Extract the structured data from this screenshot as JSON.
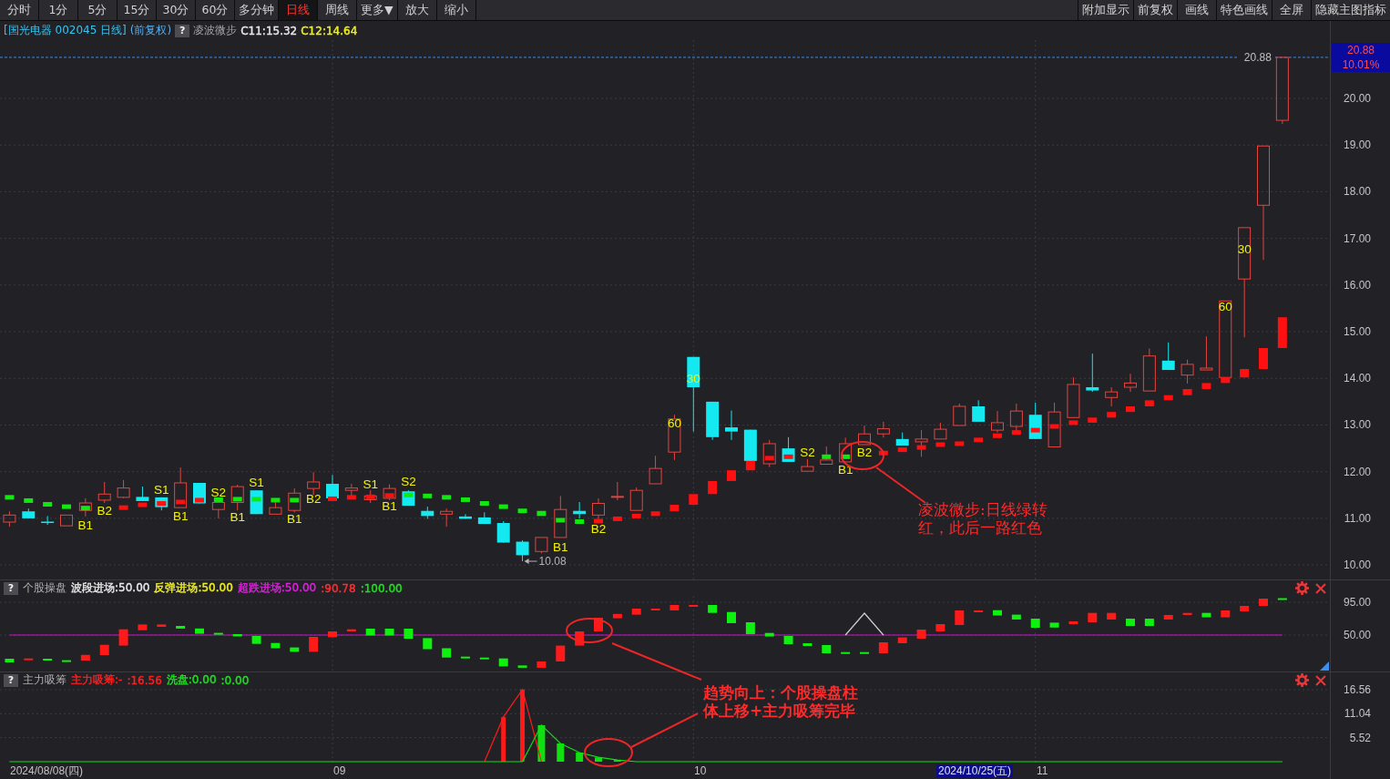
{
  "toolbar": {
    "left": [
      {
        "label": "分时",
        "selected": false
      },
      {
        "label": "1分",
        "selected": false
      },
      {
        "label": "5分",
        "selected": false
      },
      {
        "label": "15分",
        "selected": false
      },
      {
        "label": "30分",
        "selected": false
      },
      {
        "label": "60分",
        "selected": false
      },
      {
        "label": "多分钟",
        "selected": false
      },
      {
        "label": "日线",
        "selected": true
      },
      {
        "label": "周线",
        "selected": false
      },
      {
        "label": "更多▼",
        "selected": false
      },
      {
        "label": "放大",
        "selected": false
      },
      {
        "label": "缩小",
        "selected": false
      }
    ],
    "right": [
      "附加显示",
      "前复权",
      "画线",
      "特色画线",
      "全屏",
      "隐藏主图指标"
    ]
  },
  "info_bar": {
    "title": "[国光电器 002045 日线]",
    "adjust": "(前复权)",
    "help": "?",
    "indicator": "凌波微步",
    "values": [
      {
        "text": "C11:15.32",
        "color": "#e8e8e8"
      },
      {
        "text": "C12:14.64",
        "color": "#f0f020"
      }
    ]
  },
  "main_chart": {
    "last_price": "20.88",
    "change": "10.01%",
    "price_line": "20.88",
    "low": "10.08",
    "signals": [
      "B1",
      "B2",
      "S1",
      "B1",
      "S2",
      "B1",
      "S1",
      "B1",
      "B2",
      "S1",
      "B1",
      "S2",
      "B1",
      "B2",
      "60",
      "30",
      "S2",
      "B1",
      "B2",
      "60",
      "30"
    ],
    "axis_labels": [
      "20.00",
      "19.00",
      "18.00",
      "17.00",
      "16.00",
      "15.00",
      "14.00",
      "13.00",
      "12.00",
      "11.00",
      "10.00"
    ]
  },
  "panels": [
    {
      "help": "?",
      "title": "个股操盘",
      "values": [
        {
          "text": "波段进场:50.00",
          "color": "#e8e8e8"
        },
        {
          "text": "反弹进场:50.00",
          "color": "#f0f020"
        },
        {
          "text": "超跌进场:50.00",
          "color": "#e020e0"
        },
        {
          "text": ":90.78",
          "color": "#ff3030"
        },
        {
          "text": ":100.00",
          "color": "#20e020"
        }
      ],
      "kind": "sticks",
      "axis_labels": [
        "95.00",
        "50.00"
      ]
    },
    {
      "help": "?",
      "title": "主力吸筹",
      "values": [
        {
          "text": "主力吸筹:-",
          "color": "#ff2020"
        },
        {
          "text": ":16.56",
          "color": "#ff2020"
        },
        {
          "text": "洗盘:0.00",
          "color": "#20e020"
        },
        {
          "text": ":0.00",
          "color": "#20e020"
        }
      ],
      "kind": "columns",
      "chart_data": {
        "type": "bar",
        "grid": true,
        "ylim": [
          -0.42,
          16.98
        ],
        "yticks": [
          {
            "value": 16.56,
            "label": "16.56"
          },
          {
            "value": 11.04,
            "label": "11.04"
          },
          {
            "value": 5.52,
            "label": "5.52"
          }
        ],
        "series": [
          {
            "color": "#ff1a1a",
            "values": [
              0,
              0,
              0,
              0,
              0,
              0,
              0,
              0,
              0,
              0,
              0,
              0,
              0,
              0,
              0,
              0,
              0,
              0,
              0,
              0,
              0,
              0,
              0,
              0,
              0,
              0,
              10.3,
              16.6,
              0,
              0,
              0,
              0,
              0,
              0,
              0,
              0,
              0,
              0,
              0,
              0,
              0,
              0,
              0,
              0,
              0,
              0,
              0,
              0,
              0,
              0,
              0,
              0,
              0,
              0,
              0,
              0,
              0,
              0,
              0,
              0,
              0,
              0,
              0,
              0,
              0,
              0,
              0,
              0,
              null,
              null
            ]
          },
          {
            "color": "#10e010",
            "values": [
              0,
              0,
              0,
              0,
              0,
              0,
              0,
              0,
              0,
              0,
              0,
              0,
              0,
              0,
              0,
              0,
              0,
              0,
              0,
              0,
              0,
              0,
              0,
              0,
              0,
              0,
              0,
              0,
              8.4,
              4.2,
              2.1,
              1.0,
              0.4,
              0,
              0,
              0,
              0,
              0,
              0,
              0,
              0,
              0,
              0,
              0,
              0,
              0,
              0,
              0,
              0,
              0,
              0,
              0,
              0,
              0,
              0,
              0,
              0,
              0,
              0,
              0,
              0,
              0,
              0,
              0,
              0,
              0,
              0,
              0,
              null,
              null
            ]
          },
          {
            "type": "line",
            "color": "#ff1a1a",
            "values": [
              null,
              null,
              null,
              null,
              null,
              null,
              null,
              null,
              null,
              null,
              null,
              null,
              null,
              null,
              null,
              null,
              null,
              null,
              null,
              null,
              null,
              null,
              null,
              null,
              null,
              0,
              10.3,
              16.6,
              0,
              null,
              null,
              null,
              null,
              null,
              null,
              null,
              null,
              null,
              null,
              null,
              null,
              null,
              null,
              null,
              null,
              null,
              null,
              null,
              null,
              null,
              null,
              null,
              null,
              null,
              null,
              null,
              null,
              null,
              null,
              null,
              null,
              null,
              null,
              null,
              null,
              null,
              null,
              null,
              null,
              null
            ]
          },
          {
            "type": "line",
            "color": "#10e010",
            "values": [
              0,
              0,
              0,
              0,
              0,
              0,
              0,
              0,
              0,
              0,
              0,
              0,
              0,
              0,
              0,
              0,
              0,
              0,
              0,
              0,
              0,
              0,
              0,
              0,
              0,
              0,
              0,
              0,
              8.4,
              4.2,
              2.1,
              1.0,
              0.4,
              0,
              0,
              0,
              0,
              0,
              0,
              0,
              0,
              0,
              0,
              0,
              0,
              0,
              0,
              0,
              0,
              0,
              0,
              0,
              0,
              0,
              0,
              0,
              0,
              0,
              0,
              0,
              0,
              0,
              0,
              0,
              0,
              0,
              0,
              0,
              null,
              null
            ]
          }
        ]
      }
    }
  ],
  "date_axis": {
    "labels": [
      "2024/08/08(四)",
      "09",
      "10",
      "11"
    ],
    "cursor": "2024/10/25(五)"
  },
  "callouts": [
    {
      "text": "凌波微步:日线绿转红，此后一路红色"
    },
    {
      "text": "趋势向上：个股操盘柱体上移+主力吸筹完毕"
    }
  ]
}
